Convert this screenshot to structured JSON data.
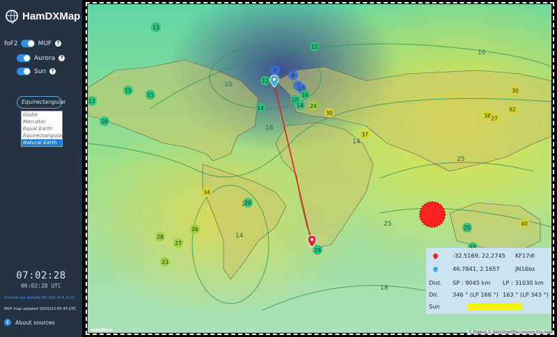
{
  "app": {
    "title": "HamDXMap"
  },
  "layers": {
    "fof2_label": "foF2",
    "items": [
      {
        "label": "MUF"
      },
      {
        "label": "Aurora"
      },
      {
        "label": "Sun"
      }
    ]
  },
  "projection": {
    "selected": "Equirectangular",
    "options": [
      "Globe",
      "Mercator",
      "Equal Earth",
      "Equirectangular",
      "Natural Earth"
    ],
    "highlighted": "Natural Earth"
  },
  "clock": {
    "time": "07:02:28",
    "utc": "06:02:28 UTC"
  },
  "status": {
    "sun_activity": "Current sun activity SFI 215, K 4, A 21",
    "muf_updated": "MUF map updated 10/02/23 05:45 UTC"
  },
  "about": {
    "label": "About sources"
  },
  "map": {
    "attribution": "© Mapbox © OpenStreetMap Improve this map",
    "logo": "mapbox",
    "contour_labels": [
      "10",
      "10",
      "14",
      "14",
      "18",
      "18",
      "20",
      "25",
      "25"
    ],
    "stations": [
      {
        "v": "13",
        "c": "#29c080"
      },
      {
        "v": "12",
        "c": "#29c080"
      },
      {
        "v": "15",
        "c": "#29c080"
      },
      {
        "v": "15",
        "c": "#29c080"
      },
      {
        "v": "12",
        "c": "#29c080"
      },
      {
        "v": "14",
        "c": "#29c080"
      },
      {
        "v": "16",
        "c": "#29c080"
      },
      {
        "v": "7",
        "c": "#3b6fd8"
      },
      {
        "v": "8",
        "c": "#3b6fd8"
      },
      {
        "v": "7",
        "c": "#3b6fd8"
      },
      {
        "v": "13",
        "c": "#3b6fd8"
      },
      {
        "v": "12",
        "c": "#29c080"
      },
      {
        "v": "16",
        "c": "#29c080"
      },
      {
        "v": "10",
        "c": "#29c080"
      },
      {
        "v": "14",
        "c": "#29c080"
      },
      {
        "v": "24",
        "c": "#9bd23a"
      },
      {
        "v": "30",
        "c": "#d9d42a"
      },
      {
        "v": "37",
        "c": "#d9d42a"
      },
      {
        "v": "30",
        "c": "#d9d42a"
      },
      {
        "v": "38",
        "c": "#d9d42a"
      },
      {
        "v": "27",
        "c": "#d9d42a"
      },
      {
        "v": "92",
        "c": "#d9d42a"
      },
      {
        "v": "34",
        "c": "#e0d82a"
      },
      {
        "v": "20",
        "c": "#29c080"
      },
      {
        "v": "26",
        "c": "#9bd23a"
      },
      {
        "v": "28",
        "c": "#9bd23a"
      },
      {
        "v": "27",
        "c": "#9bd23a"
      },
      {
        "v": "23",
        "c": "#9bd23a"
      },
      {
        "v": "19",
        "c": "#29c080"
      },
      {
        "v": "25",
        "c": "#29c080"
      },
      {
        "v": "40",
        "c": "#d9d42a"
      },
      {
        "v": "15",
        "c": "#29c080"
      }
    ]
  },
  "info": {
    "point_a": {
      "coords": "-32.5169, 22.2745",
      "locator": "KF17dl"
    },
    "point_b": {
      "coords": "46.7841, 2.1657",
      "locator": "JN16bs"
    },
    "dist": {
      "label": "Dist.",
      "sp": "SP : 9045 km",
      "lp": "LP : 31030 km"
    },
    "dir": {
      "label": "Dir.",
      "sp": "346 ° (LP 166 °)",
      "lp": "163 ° (LP 343 °)"
    },
    "sun": {
      "label": "Sun"
    },
    "colors": {
      "a": "#e8262a",
      "b": "#3fa9d8",
      "path": "#e02020",
      "sun_bar": "#f4f20a"
    }
  }
}
